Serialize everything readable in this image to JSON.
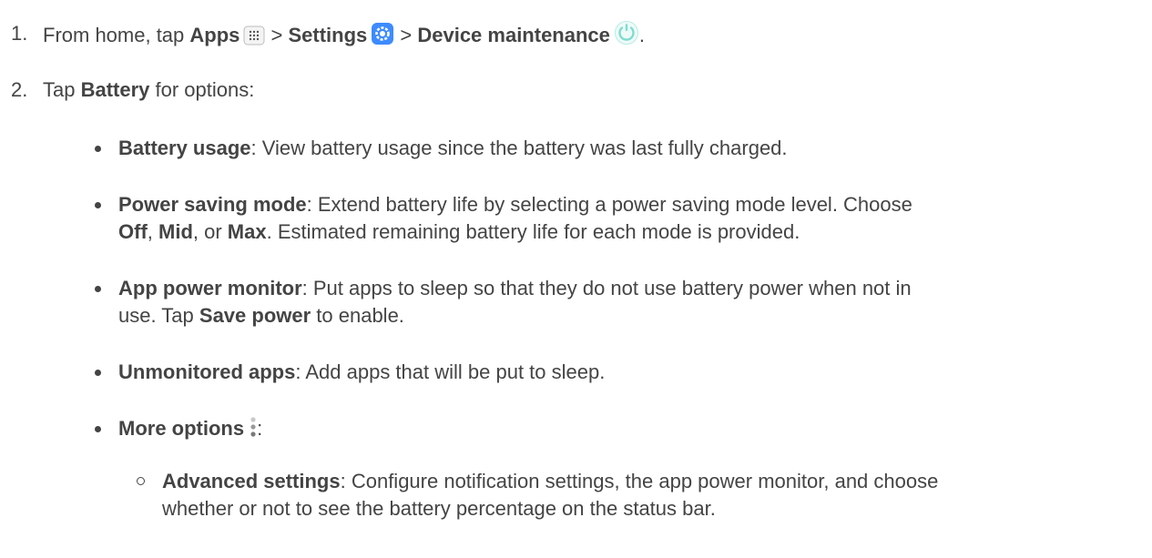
{
  "step1": {
    "num": "1.",
    "pre": "From home, tap ",
    "apps": "Apps",
    "sep1": " > ",
    "settings": "Settings",
    "sep2": " > ",
    "device": "Device maintenance",
    "end": "."
  },
  "step2": {
    "num": "2.",
    "pre": "Tap ",
    "battery": "Battery",
    "post": " for options:"
  },
  "bullets": {
    "usage": {
      "title": "Battery usage",
      "text": ": View battery usage since the battery was last fully charged."
    },
    "power": {
      "title": "Power saving mode",
      "text1": ": Extend battery life by selecting a power saving mode level. Choose",
      "off": "Off",
      "c1": ", ",
      "mid": "Mid",
      "c2": ", or ",
      "max": "Max",
      "text2": ". Estimated remaining battery life for each mode is provided."
    },
    "monitor": {
      "title": "App power monitor",
      "text1": ": Put apps to sleep so that they do not use battery power when not in",
      "text2": "use. Tap ",
      "save": "Save power",
      "text3": " to enable."
    },
    "unmonitored": {
      "title": "Unmonitored apps",
      "text": ": Add apps that will be put to sleep."
    },
    "more": {
      "title": "More options",
      "text": ":"
    }
  },
  "sub": {
    "advanced": {
      "title": "Advanced settings",
      "text1": ": Configure notification settings, the app power monitor, and choose",
      "text2": "whether or not to see the battery percentage on the status bar."
    }
  },
  "icons": {
    "apps": "apps-grid-icon",
    "settings": "settings-gear-icon",
    "device": "device-maintenance-icon",
    "more": "more-options-icon"
  },
  "colors": {
    "text": "#444444",
    "settings_icon": "#3d8bff",
    "device_icon": "#7fdcd0"
  }
}
